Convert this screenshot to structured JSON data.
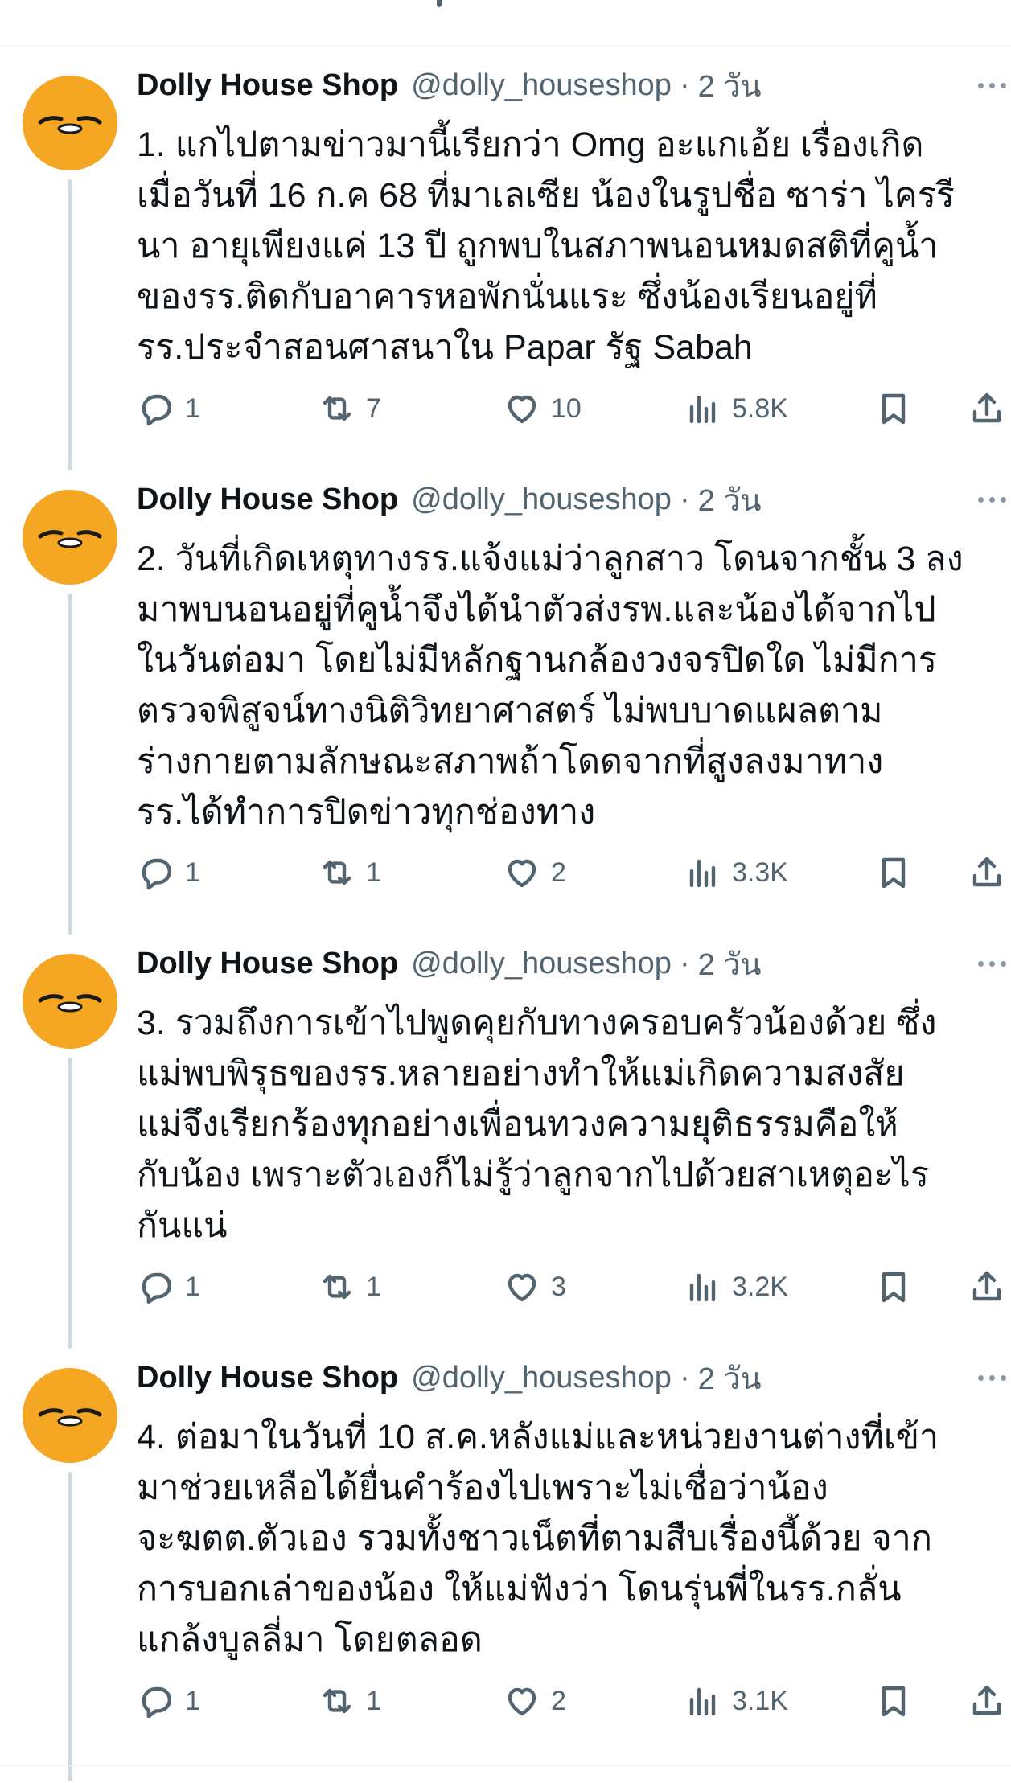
{
  "thread": {
    "tweets": [
      {
        "author_name": "Dolly House Shop",
        "handle": "@dolly_houseshop",
        "separator": "·",
        "time": "2 วัน",
        "text": "1. แกไปตามข่าวมานี้เรียกว่า Omg อะแกเอ้ย เรื่องเกิด\nเมื่อวันที่ 16 ก.ค 68 ที่มาเลเซีย น้องในรูปชื่อ ซาร่า ไครรี\nนา อายุเพียงแค่ 13 ปี ถูกพบในสภาพนอนหมดสติที่คูน้ำ\nของรร.ติดกับอาคารหอพักนั่นแระ ซึ่งน้องเรียนอยู่ที่\nรร.ประจำสอนศาสนาใน Papar รัฐ Sabah",
        "replies": "1",
        "retweets": "7",
        "likes": "10",
        "views": "5.8K"
      },
      {
        "author_name": "Dolly House Shop",
        "handle": "@dolly_houseshop",
        "separator": "·",
        "time": "2 วัน",
        "text": "2. วันที่เกิดเหตุทางรร.แจ้งแม่ว่าลูกสาว โดนจากชั้น 3 ลง\nมาพบนอนอยู่ที่คูน้ำจึงได้นำตัวส่งรพ.และน้องได้จากไป\nในวันต่อมา โดยไม่มีหลักฐานกล้องวงจรปิดใด ไม่มีการ\nตรวจพิสูจน์ทางนิติวิทยาศาสตร์ ไม่พบบาดแผลตาม\nร่างกายตามลักษณะสภาพถ้าโดดจากที่สูงลงมาทาง\nรร.ได้ทำการปิดข่าวทุกช่องทาง",
        "replies": "1",
        "retweets": "1",
        "likes": "2",
        "views": "3.3K"
      },
      {
        "author_name": "Dolly House Shop",
        "handle": "@dolly_houseshop",
        "separator": "·",
        "time": "2 วัน",
        "text": "3. รวมถึงการเข้าไปพูดคุยกับทางครอบครัวน้องด้วย ซึ่ง\nแม่พบพิรุธของรร.หลายอย่างทำให้แม่เกิดความสงสัย\nแม่จึงเรียกร้องทุกอย่างเพื่อนทวงความยุติธรรมคือให้\nกับน้อง เพราะตัวเองก็ไม่รู้ว่าลูกจากไปด้วยสาเหตุอะไร\nกันแน่",
        "replies": "1",
        "retweets": "1",
        "likes": "3",
        "views": "3.2K"
      },
      {
        "author_name": "Dolly House Shop",
        "handle": "@dolly_houseshop",
        "separator": "·",
        "time": "2 วัน",
        "text": "4. ต่อมาในวันที่ 10 ส.ค.หลังแม่และหน่วยงานต่างที่เข้า\nมาช่วยเหลือได้ยื่นคำร้องไปเพราะไม่เชื่อว่าน้อง\nจะฆตต.ตัวเอง รวมทั้งชาวเน็ตที่ตามสืบเรื่องนี้ด้วย จาก\nการบอกเล่าของน้อง ให้แม่ฟังว่า โดนรุ่นพี่ในรร.กลั่น\nแกล้งบูลลี่มา โดยตลอด",
        "replies": "1",
        "retweets": "1",
        "likes": "2",
        "views": "3.1K"
      }
    ]
  },
  "icons": {
    "reply": "speech-bubble-icon",
    "retweet": "retweet-arrows-icon",
    "like": "heart-icon",
    "views": "bar-chart-icon",
    "bookmark": "bookmark-icon",
    "share": "share-upload-icon",
    "more": "more-horizontal-icon",
    "avatar": "gudetama-face-avatar"
  },
  "colors": {
    "text_primary": "#0f1419",
    "text_secondary": "#536471",
    "thread_line": "#cfd9de",
    "avatar_bg": "#f5a623"
  }
}
